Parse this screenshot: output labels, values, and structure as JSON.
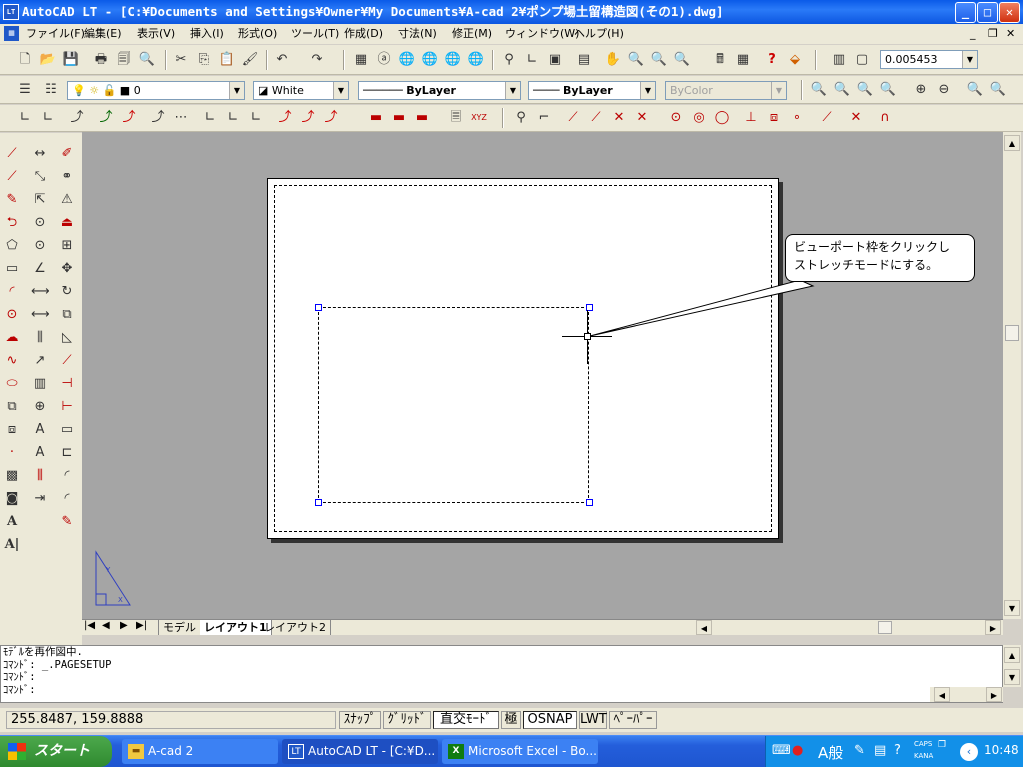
{
  "window": {
    "title": "AutoCAD LT - [C:¥Documents and Settings¥Owner¥My Documents¥A-cad 2¥ポンプ場土留構造図(その1).dwg]",
    "icon_label": "LT"
  },
  "menu": [
    "ファイル(F)",
    "編集(E)",
    "表示(V)",
    "挿入(I)",
    "形式(O)",
    "ツール(T)",
    "作成(D)",
    "寸法(N)",
    "修正(M)",
    "ウィンドウ(W)",
    "ヘルプ(H)"
  ],
  "toolbar": {
    "scale_value": "0.005453",
    "layer_value": "0",
    "color_value": "White",
    "linetype_value": "ByLayer",
    "lineweight_value": "ByLayer",
    "plotstyle_value": "ByColor"
  },
  "callout": {
    "line1": "ビューポート枠をクリックし",
    "line2": "ストレッチモードにする。"
  },
  "tabs": [
    "モデル",
    "レイアウト1",
    "レイアウト2"
  ],
  "command_lines": [
    "ﾓﾃﾞﾙを再作図中.",
    "ｺﾏﾝﾄﾞ: _.PAGESETUP",
    "ｺﾏﾝﾄﾞ:",
    "ｺﾏﾝﾄﾞ:"
  ],
  "status": {
    "coords": "255.8487, 159.8888",
    "snap": "ｽﾅｯﾌﾟ",
    "grid": "ｸﾞﾘｯﾄﾞ",
    "ortho": "直交ﾓｰﾄﾞ",
    "polar": "極",
    "osnap": "OSNAP",
    "lwt": "LWT",
    "paper": "ﾍﾟｰﾊﾟｰ"
  },
  "taskbar": {
    "start": "スタート",
    "tasks": [
      "A-cad 2",
      "AutoCAD LT - [C:¥D...",
      "Microsoft Excel - Bo..."
    ],
    "ime": "A般",
    "caps": "CAPS",
    "kana": "KANA",
    "clock": "10:48"
  }
}
